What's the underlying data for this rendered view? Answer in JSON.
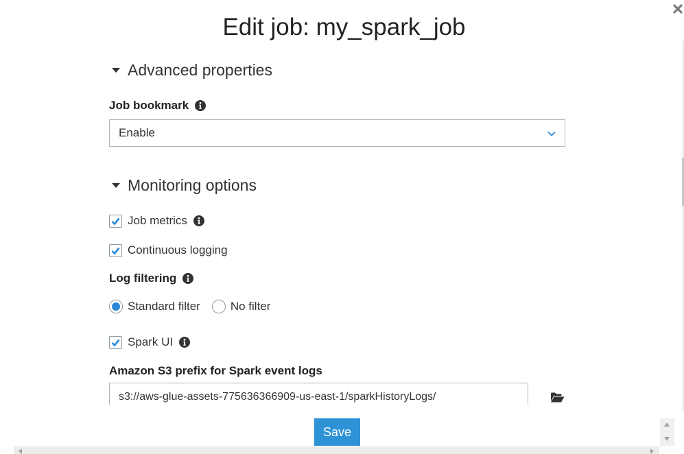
{
  "dialog": {
    "title": "Edit job: my_spark_job"
  },
  "advanced": {
    "header": "Advanced properties",
    "job_bookmark": {
      "label": "Job bookmark",
      "selected": "Enable"
    }
  },
  "monitoring": {
    "header": "Monitoring options",
    "job_metrics": {
      "label": "Job metrics",
      "checked": true
    },
    "continuous_logging": {
      "label": "Continuous logging",
      "checked": true
    },
    "log_filtering": {
      "label": "Log filtering",
      "options": [
        {
          "label": "Standard filter",
          "selected": true
        },
        {
          "label": "No filter",
          "selected": false
        }
      ]
    },
    "spark_ui": {
      "label": "Spark UI",
      "checked": true
    },
    "s3_prefix": {
      "label": "Amazon S3 prefix for Spark event logs",
      "value": "s3://aws-glue-assets-775636366909-us-east-1/sparkHistoryLogs/"
    }
  },
  "footer": {
    "save_label": "Save"
  },
  "icons": {
    "close": "close-icon",
    "info": "info-icon",
    "chevron": "chevron-down-icon",
    "caret": "caret-down-icon",
    "folder": "folder-open-icon",
    "checkmark": "checkmark-icon"
  },
  "colors": {
    "primary": "#2e92d6",
    "check": "#2b88d8",
    "text": "#333333",
    "border": "#aab7b8"
  }
}
